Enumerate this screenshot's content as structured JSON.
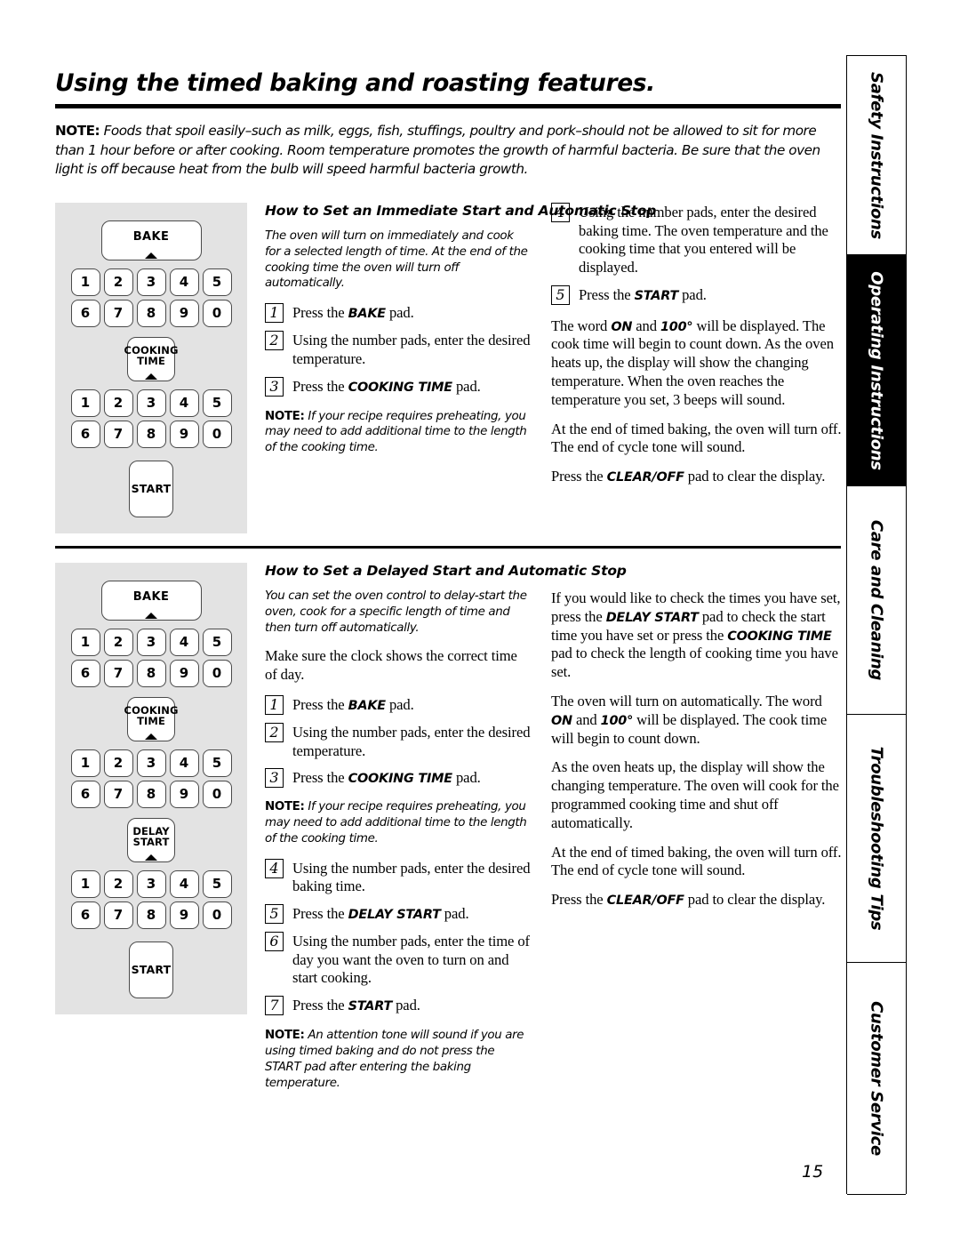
{
  "document": {
    "title": "Using the timed baking and roasting features.",
    "page_number": "15",
    "intro_note_label": "NOTE:",
    "intro_note_text": "Foods that spoil easily–such as milk, eggs, fish, stuffings, poultry and pork–should not be allowed to sit for more than 1 hour before or after cooking. Room temperature promotes the growth of harmful bacteria. Be sure that the oven light is off because heat from the bulb will speed harmful bacteria growth."
  },
  "tabs": [
    {
      "label": "Safety Instructions",
      "active": false
    },
    {
      "label": "Operating Instructions",
      "active": true
    },
    {
      "label": "Care and Cleaning",
      "active": false
    },
    {
      "label": "Troubleshooting Tips",
      "active": false
    },
    {
      "label": "Customer Service",
      "active": false
    }
  ],
  "panel1": {
    "bake": "BAKE",
    "cooking_time_line1": "COOKING",
    "cooking_time_line2": "TIME",
    "start": "START",
    "numbers_row1": [
      "1",
      "2",
      "3",
      "4",
      "5"
    ],
    "numbers_row2": [
      "6",
      "7",
      "8",
      "9",
      "0"
    ]
  },
  "panel2": {
    "bake": "BAKE",
    "cooking_time_line1": "COOKING",
    "cooking_time_line2": "TIME",
    "delay_start_line1": "DELAY",
    "delay_start_line2": "START",
    "start": "START",
    "numbers_row1": [
      "1",
      "2",
      "3",
      "4",
      "5"
    ],
    "numbers_row2": [
      "6",
      "7",
      "8",
      "9",
      "0"
    ]
  },
  "section1": {
    "heading": "How to Set an Immediate Start and Automatic Stop",
    "intro": "The oven will turn on immediately and cook for a selected length of time. At the end of the cooking time the oven will turn off automatically.",
    "steps": [
      {
        "num": "1",
        "html": "Press the <b>BAKE</b> pad."
      },
      {
        "num": "2",
        "html": "Using the number pads, enter the desired temperature."
      },
      {
        "num": "3",
        "html": "Press the <b>COOKING TIME</b> pad."
      },
      {
        "num": "4",
        "html": "Using the number pads, enter the desired baking time. The oven temperature and the cooking time that you entered will be displayed."
      },
      {
        "num": "5",
        "html": "Press the <b>START</b> pad."
      }
    ],
    "note_label": "NOTE:",
    "note_text": "If your recipe requires preheating, you may need to add additional time to the length of the cooking time.",
    "para_on": "The word <b>ON</b> and <b>100°</b> will be displayed. The cook time will begin to count down. As the oven heats up, the display will show the changing temperature. When the oven reaches the temperature you set, 3 beeps will sound.",
    "para_end": "At the end of timed baking, the oven will turn off. The end of cycle tone will sound.",
    "para_clear": "Press the <b>CLEAR/OFF</b> pad to clear the display."
  },
  "section2": {
    "heading": "How to Set a Delayed Start and Automatic Stop",
    "intro": "You can set the oven control to delay-start the oven, cook for a specific length of time and then turn off automatically.",
    "clock_para": "Make sure the clock shows the correct time of day.",
    "steps": [
      {
        "num": "1",
        "html": "Press the <b>BAKE</b> pad."
      },
      {
        "num": "2",
        "html": "Using the number pads, enter the desired temperature."
      },
      {
        "num": "3",
        "html": "Press the <b>COOKING TIME</b> pad."
      },
      {
        "num": "4",
        "html": "Using the number pads, enter the desired baking time."
      },
      {
        "num": "5",
        "html": "Press the <b>DELAY START</b> pad."
      },
      {
        "num": "6",
        "html": "Using the number pads, enter the time of day you want the oven to turn on and start cooking."
      },
      {
        "num": "7",
        "html": "Press the <b>START</b> pad."
      }
    ],
    "note1_label": "NOTE:",
    "note1_text": "If your recipe requires preheating, you may need to add additional time to the length of the cooking time.",
    "note2_label": "NOTE:",
    "note2_text": "An attention tone will sound if you are using timed baking and do not press the START pad after entering the baking temperature.",
    "para_check": "If you would like to check the times you have set, press the <b>DELAY START</b> pad to check the start time you have set or press the <b>COOKING TIME</b> pad to check the length of cooking time you have set.",
    "para_auto": "The oven will turn on automatically. The word <b>ON</b> and <b>100°</b> will be displayed. The cook time will begin to count down.",
    "para_heats": "As the oven heats up, the display will show the changing temperature. The oven will cook for the programmed cooking time and shut off automatically.",
    "para_end": "At the end of timed baking, the oven will turn off. The end of cycle tone will sound.",
    "para_clear": "Press the <b>CLEAR/OFF</b> pad to clear the display."
  }
}
